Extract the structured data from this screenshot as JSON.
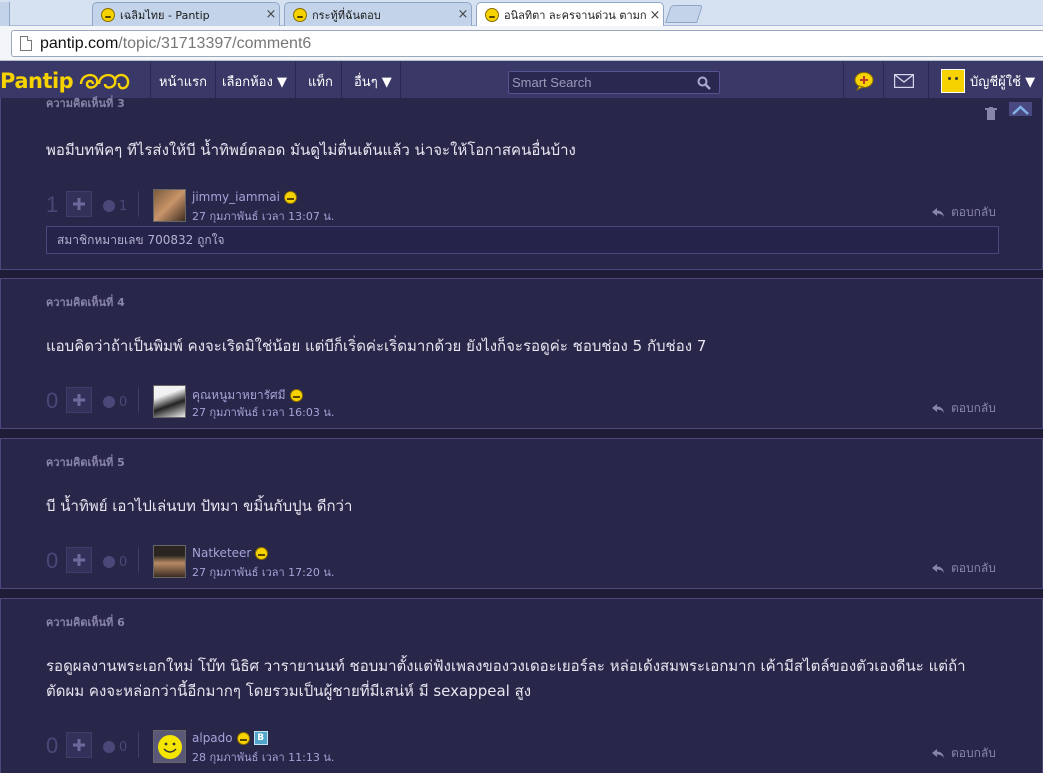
{
  "browser": {
    "tabs": [
      {
        "title": "เฉลิมไทย - Pantip",
        "close": "×",
        "active": false
      },
      {
        "title": "กระทู้ที่ฉันตอบ",
        "close": "×",
        "active": false
      },
      {
        "title": "อนิลทิตา ละครจานด่วน ตามกระ",
        "close": "×",
        "active": true
      }
    ],
    "url_host": "pantip.com",
    "url_path": "/topic/31713397/comment6"
  },
  "navbar": {
    "logo_text": "Pantip",
    "items": [
      {
        "label": "หน้าแรก"
      },
      {
        "label": "เลือกห้อง ▼"
      },
      {
        "label": "แท็ก"
      },
      {
        "label": "อื่นๆ ▼"
      }
    ],
    "search_placeholder": "Smart Search",
    "account_label": "บัญชีผู้ใช้ ▼"
  },
  "comments": [
    {
      "header": "ความคิดเห็นที่ 3",
      "text": "พอมีบทพีคๆ ทีไรส่งให้บี น้ำทิพย์ตลอด มันดูไม่ตื่นเต้นแล้ว น่าจะให้โอกาสคนอื่นบ้าง",
      "votes": "1",
      "emotions": "1",
      "user": "jimmy_iammai",
      "time": "27 กุมภาพันธ์ เวลา 13:07 น.",
      "reply": "ตอบกลับ",
      "liked_by": "สมาชิกหมายเลข 700832 ถูกใจ"
    },
    {
      "header": "ความคิดเห็นที่ 4",
      "text": "แอบคิดว่าถ้าเป็นพิมพ์ คงจะเริดมิใช่น้อย แต่บีก็เริ่ดค่ะเริ่ดมากด้วย  ยังไงก็จะรอดูค่ะ ชอบช่อง 5 กับช่อง 7",
      "votes": "0",
      "emotions": "0",
      "user": "คุณหนูมาหยารัศมี",
      "time": "27 กุมภาพันธ์ เวลา 16:03 น.",
      "reply": "ตอบกลับ"
    },
    {
      "header": "ความคิดเห็นที่ 5",
      "text": "บี น้ำทิพย์ เอาไปเล่นบท ปัทมา ขมิ้นกับปูน ดีกว่า",
      "votes": "0",
      "emotions": "0",
      "user": "Natketeer",
      "time": "27 กุมภาพันธ์ เวลา 17:20 น.",
      "reply": "ตอบกลับ"
    },
    {
      "header": "ความคิดเห็นที่ 6",
      "text": "รอดูผลงานพระเอกใหม่ โบ๊ท นิธิศ วารายานนท์ ชอบมาตั้งแต่ฟังเพลงของวงเดอะเยอร์ละ หล่อเด้งสมพระเอกมาก เค้ามีสไตล์ของตัวเองดีนะ แต่ถ้าตัดผม คงจะหล่อกว่านี้อีกมากๆ โดยรวมเป็นผู้ชายที่มีเสน่ห์ มี sexappeal สูง",
      "votes": "0",
      "emotions": "0",
      "user": "alpado",
      "badge": "B",
      "time": "28 กุมภาพันธ์ เวลา 11:13 น.",
      "reply": "ตอบกลับ"
    }
  ],
  "colors": {
    "page_bg": "#1e1c36",
    "panel_bg": "#282649",
    "navbar_bg": "#3a3867",
    "brand_yellow": "#f5d200",
    "username": "#a5a3d8"
  }
}
